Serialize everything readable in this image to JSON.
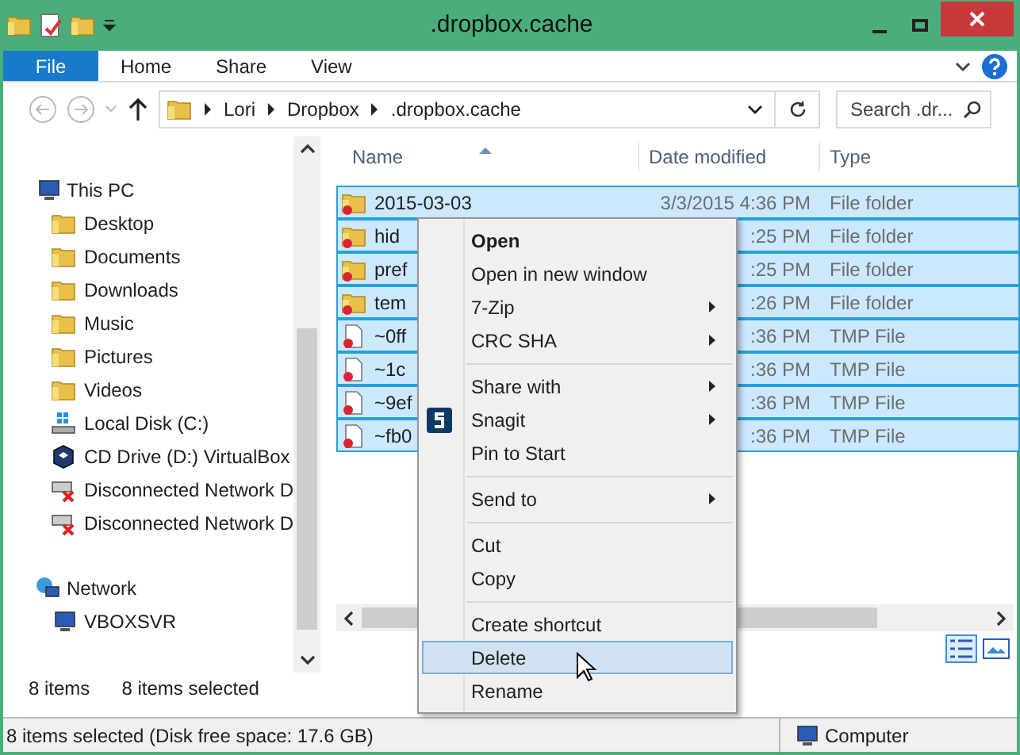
{
  "window": {
    "title": ".dropbox.cache"
  },
  "ribbon": {
    "file_button": "File",
    "tabs": [
      {
        "label": "Home",
        "selected": false
      },
      {
        "label": "Share",
        "selected": false
      },
      {
        "label": "View",
        "selected": false
      }
    ]
  },
  "address": {
    "path": [
      "Lori",
      "Dropbox",
      ".dropbox.cache"
    ]
  },
  "search": {
    "placeholder": "Search .dr..."
  },
  "sidebar": {
    "items": [
      {
        "label": "This PC",
        "children": [
          {
            "label": "Desktop"
          },
          {
            "label": "Documents"
          },
          {
            "label": "Downloads"
          },
          {
            "label": "Music"
          },
          {
            "label": "Pictures"
          },
          {
            "label": "Videos"
          },
          {
            "label": "Local Disk (C:)"
          },
          {
            "label": "CD Drive (D:) VirtualBox"
          },
          {
            "label": "Disconnected Network D"
          },
          {
            "label": "Disconnected Network D"
          }
        ]
      },
      {
        "label": "Network",
        "children": [
          {
            "label": "VBOXSVR"
          }
        ]
      }
    ]
  },
  "table": {
    "columns": [
      "Name",
      "Date modified",
      "Type"
    ],
    "rows": [
      {
        "name": "2015-03-03",
        "date": "3/3/2015 4:36 PM",
        "type": "File folder",
        "kind": "folder",
        "selected": true
      },
      {
        "name": "hid",
        "date": ":25 PM",
        "type": "File folder",
        "kind": "folder",
        "selected": true
      },
      {
        "name": "pref",
        "date": ":25 PM",
        "type": "File folder",
        "kind": "folder",
        "selected": true
      },
      {
        "name": "tem",
        "date": ":26 PM",
        "type": "File folder",
        "kind": "folder",
        "selected": true
      },
      {
        "name": "~0ff",
        "date": ":36 PM",
        "type": "TMP File",
        "kind": "file",
        "selected": true
      },
      {
        "name": "~1c",
        "date": ":36 PM",
        "type": "TMP File",
        "kind": "file",
        "selected": true
      },
      {
        "name": "~9ef",
        "date": ":36 PM",
        "type": "TMP File",
        "kind": "file",
        "selected": true
      },
      {
        "name": "~fb0",
        "date": ":36 PM",
        "type": "TMP File",
        "kind": "file",
        "selected": true
      }
    ]
  },
  "context_menu": {
    "items": [
      {
        "kind": "item",
        "label": "Open",
        "bold": true,
        "submenu": false,
        "highlighted": false
      },
      {
        "kind": "item",
        "label": "Open in new window",
        "submenu": false,
        "highlighted": false
      },
      {
        "kind": "item",
        "label": "7-Zip",
        "submenu": true,
        "highlighted": false
      },
      {
        "kind": "item",
        "label": "CRC SHA",
        "submenu": true,
        "highlighted": false
      },
      {
        "kind": "separator"
      },
      {
        "kind": "item",
        "label": "Share with",
        "submenu": true,
        "highlighted": false
      },
      {
        "kind": "item",
        "label": "Snagit",
        "submenu": true,
        "highlighted": false,
        "icon": true
      },
      {
        "kind": "item",
        "label": "Pin to Start",
        "submenu": false,
        "highlighted": false
      },
      {
        "kind": "separator"
      },
      {
        "kind": "item",
        "label": "Send to",
        "submenu": true,
        "highlighted": false
      },
      {
        "kind": "separator"
      },
      {
        "kind": "item",
        "label": "Cut",
        "submenu": false,
        "highlighted": false
      },
      {
        "kind": "item",
        "label": "Copy",
        "submenu": false,
        "highlighted": false
      },
      {
        "kind": "separator"
      },
      {
        "kind": "item",
        "label": "Create shortcut",
        "submenu": false,
        "highlighted": false
      },
      {
        "kind": "item",
        "label": "Delete",
        "submenu": false,
        "highlighted": true
      },
      {
        "kind": "item",
        "label": "Rename",
        "submenu": false,
        "highlighted": false
      }
    ]
  },
  "status_bar": {
    "count": "8 items",
    "selection": "8 items selected"
  },
  "lower_status_bar": {
    "text": "8 items selected (Disk free space: 17.6 GB)",
    "location": "Computer"
  }
}
